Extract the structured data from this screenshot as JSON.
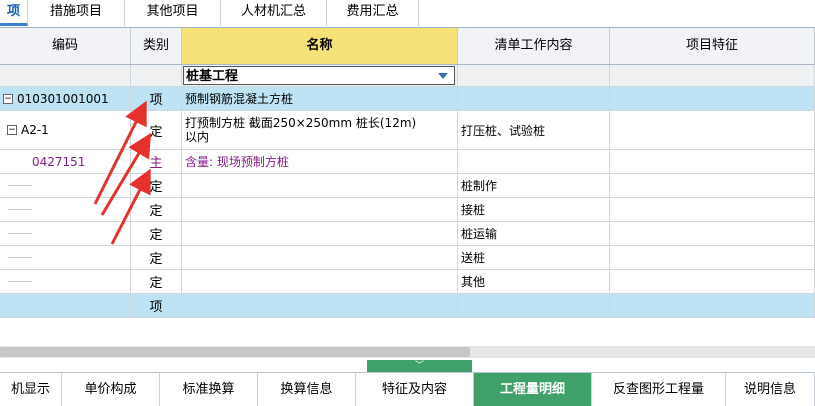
{
  "top_tabs": [
    {
      "label": "项",
      "active": true
    },
    {
      "label": "措施项目"
    },
    {
      "label": "其他项目"
    },
    {
      "label": "人材机汇总"
    },
    {
      "label": "费用汇总"
    }
  ],
  "columns": {
    "code": "编码",
    "type": "类别",
    "name": "名称",
    "work": "清单工作内容",
    "feature": "项目特征"
  },
  "rows": [
    {
      "code": "",
      "type": "",
      "name": "桩基工程",
      "work": "",
      "feature": ""
    },
    {
      "code": "010301001001",
      "type": "项",
      "name": "预制钢筋混凝土方桩",
      "work": "",
      "feature": ""
    },
    {
      "code": "A2-1",
      "type": "定",
      "name_line1": "打预制方桩 截面250×250mm 桩长(12m)",
      "name_line2": "以内",
      "work": "打压桩、试验桩",
      "feature": ""
    },
    {
      "code": "0427151",
      "type": "主",
      "name": "含量: 现场预制方桩",
      "work": "",
      "feature": ""
    },
    {
      "code": "",
      "type": "定",
      "name": "",
      "work": "桩制作",
      "feature": ""
    },
    {
      "code": "",
      "type": "定",
      "name": "",
      "work": "接桩",
      "feature": ""
    },
    {
      "code": "",
      "type": "定",
      "name": "",
      "work": "桩运输",
      "feature": ""
    },
    {
      "code": "",
      "type": "定",
      "name": "",
      "work": "送桩",
      "feature": ""
    },
    {
      "code": "",
      "type": "定",
      "name": "",
      "work": "其他",
      "feature": ""
    },
    {
      "code": "",
      "type": "项",
      "name": "",
      "work": "",
      "feature": ""
    }
  ],
  "bottom_tabs": [
    {
      "label": "机显示"
    },
    {
      "label": "单价构成"
    },
    {
      "label": "标准换算"
    },
    {
      "label": "换算信息"
    },
    {
      "label": "特征及内容"
    },
    {
      "label": "工程量明细",
      "active": true
    },
    {
      "label": "反查图形工程量"
    },
    {
      "label": "说明信息"
    }
  ],
  "colors": {
    "accent_green": "#3fa06a",
    "highlight_blue": "#bde3f5",
    "name_header": "#f7e27a",
    "arrow_red": "#e5322d"
  }
}
